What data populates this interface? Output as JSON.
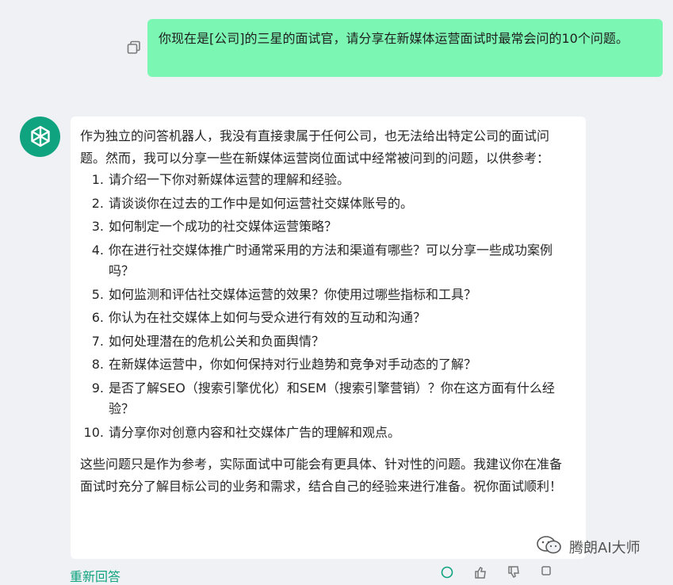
{
  "user_message": {
    "text": "你现在是[公司]的三星的面试官，请分享在新媒体运营面试时最常会问的10个问题。"
  },
  "assistant_message": {
    "intro": "作为独立的问答机器人，我没有直接隶属于任何公司，也无法给出特定公司的面试问题。然而，我可以分享一些在新媒体运营岗位面试中经常被问到的问题，以供参考：",
    "questions": [
      {
        "num": "1.",
        "text": "请介绍一下你对新媒体运营的理解和经验。"
      },
      {
        "num": "2.",
        "text": "请谈谈你在过去的工作中是如何运营社交媒体账号的。"
      },
      {
        "num": "3.",
        "text": "如何制定一个成功的社交媒体运营策略？"
      },
      {
        "num": "4.",
        "text": "你在进行社交媒体推广时通常采用的方法和渠道有哪些？可以分享一些成功案例吗？"
      },
      {
        "num": "5.",
        "text": "如何监测和评估社交媒体运营的效果？你使用过哪些指标和工具？"
      },
      {
        "num": "6.",
        "text": "你认为在社交媒体上如何与受众进行有效的互动和沟通？"
      },
      {
        "num": "7.",
        "text": "如何处理潜在的危机公关和负面舆情？"
      },
      {
        "num": "8.",
        "text": "在新媒体运营中，你如何保持对行业趋势和竞争对手动态的了解？"
      },
      {
        "num": "9.",
        "text": "是否了解SEO（搜索引擎优化）和SEM（搜索引擎营销）？你在这方面有什么经验？"
      },
      {
        "num": "10.",
        "text": "请分享你对创意内容和社交媒体广告的理解和观点。"
      }
    ],
    "outro": "这些问题只是作为参考，实际面试中可能会有更具体、针对性的问题。我建议你在准备面试时充分了解目标公司的业务和需求，结合自己的经验来进行准备。祝你面试顺利！"
  },
  "regenerate_label": "重新回答",
  "watermark": {
    "text": "腾朗AI大师",
    "icon": "wechat-icon"
  },
  "colors": {
    "user_bubble": "#7cf7b3",
    "assistant_avatar": "#10a37f",
    "background": "#eff1f5"
  }
}
